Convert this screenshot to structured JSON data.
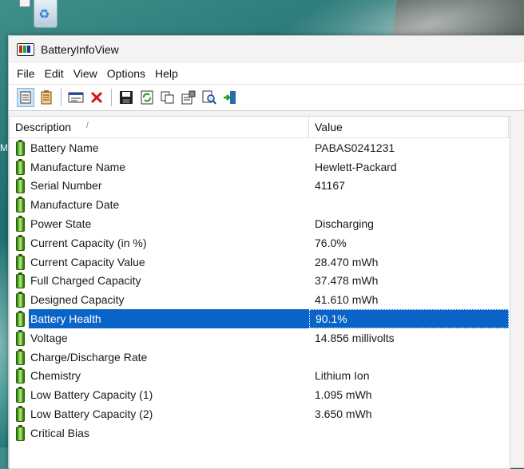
{
  "window": {
    "title": "BatteryInfoView"
  },
  "desktop": {
    "stray_letter": "M"
  },
  "menu": [
    "File",
    "Edit",
    "View",
    "Options",
    "Help"
  ],
  "toolbar": {
    "buttons": [
      "properties-view-icon",
      "list-view-icon",
      "html-report-icon",
      "delete-icon",
      "save-icon",
      "refresh-icon",
      "copy-icon",
      "properties-icon",
      "find-icon",
      "exit-icon"
    ]
  },
  "columns": {
    "description": "Description",
    "value": "Value",
    "sort_indicator": "/"
  },
  "rows": [
    {
      "label": "Battery Name",
      "value": "PABAS0241231"
    },
    {
      "label": "Manufacture Name",
      "value": "Hewlett-Packard"
    },
    {
      "label": "Serial Number",
      "value": "41167"
    },
    {
      "label": "Manufacture Date",
      "value": ""
    },
    {
      "label": "Power State",
      "value": "Discharging"
    },
    {
      "label": "Current Capacity (in %)",
      "value": "76.0%"
    },
    {
      "label": "Current Capacity Value",
      "value": "28.470 mWh"
    },
    {
      "label": "Full Charged Capacity",
      "value": "37.478 mWh"
    },
    {
      "label": "Designed Capacity",
      "value": "41.610 mWh"
    },
    {
      "label": "Battery Health",
      "value": "90.1%",
      "selected": true
    },
    {
      "label": "Voltage",
      "value": "14.856 millivolts"
    },
    {
      "label": "Charge/Discharge Rate",
      "value": ""
    },
    {
      "label": "Chemistry",
      "value": "Lithium Ion"
    },
    {
      "label": "Low Battery Capacity (1)",
      "value": "1.095 mWh"
    },
    {
      "label": "Low Battery Capacity (2)",
      "value": "3.650 mWh"
    },
    {
      "label": "Critical Bias",
      "value": ""
    }
  ],
  "colors": {
    "selection": "#0a64c8",
    "battery_green": "#6cbf36"
  }
}
